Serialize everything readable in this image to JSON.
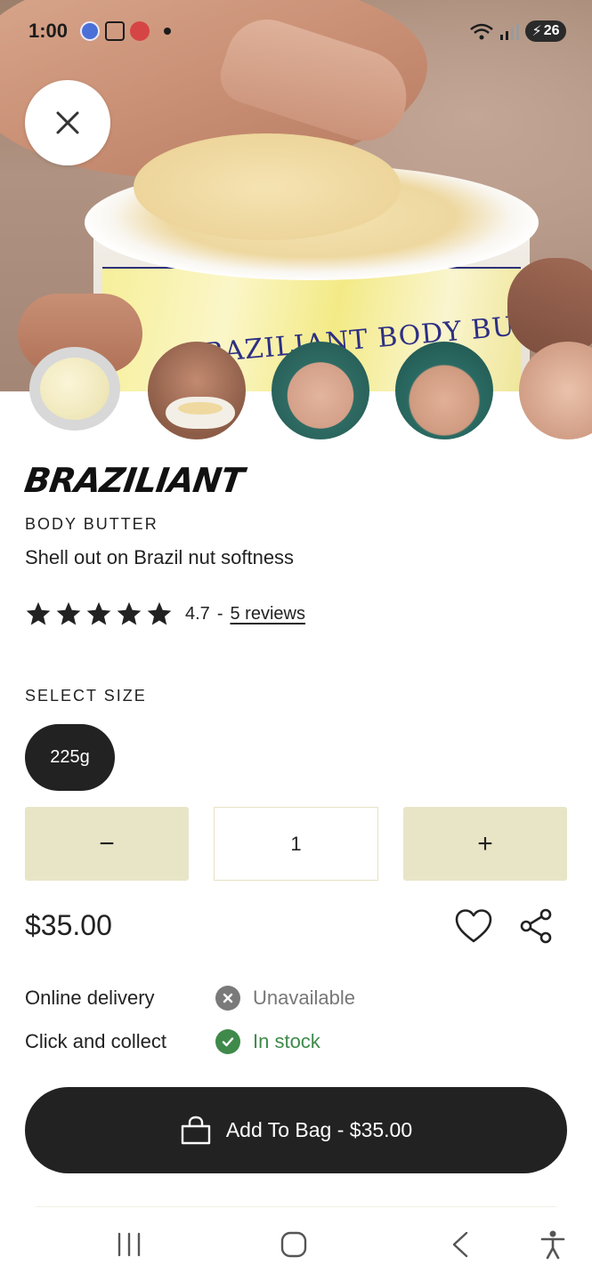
{
  "status_bar": {
    "time": "1:00",
    "battery": "26"
  },
  "hero": {
    "jar_label_text": "BRAZILIANT BODY BUTTER"
  },
  "product": {
    "brand": "BRAZILIANT",
    "category": "BODY BUTTER",
    "tagline": "Shell out on Brazil nut softness",
    "rating": {
      "stars": 5,
      "value": "4.7",
      "separator": "-",
      "reviews_label": "5 reviews"
    },
    "thumbnails": [
      {
        "name": "thumb-product",
        "selected": true
      },
      {
        "name": "thumb-jar-hand",
        "selected": false
      },
      {
        "name": "thumb-shoulder",
        "selected": false
      },
      {
        "name": "thumb-model",
        "selected": false
      },
      {
        "name": "thumb-applying",
        "selected": false
      }
    ]
  },
  "size": {
    "label": "SELECT SIZE",
    "options": [
      "225g"
    ],
    "selected": "225g"
  },
  "quantity": {
    "minus": "−",
    "value": "1",
    "plus": "+"
  },
  "price": "$35.00",
  "availability": [
    {
      "label": "Online delivery",
      "status": "Unavailable",
      "state": "unavailable"
    },
    {
      "label": "Click and collect",
      "status": "In stock",
      "state": "in-stock"
    }
  ],
  "add_to_bag": {
    "label": "Add To Bag - $35.00"
  },
  "colors": {
    "accent_button": "#e8e5c7",
    "dark": "#222222",
    "in_stock": "#3f8a4a",
    "unavailable": "#7a7a7a"
  }
}
